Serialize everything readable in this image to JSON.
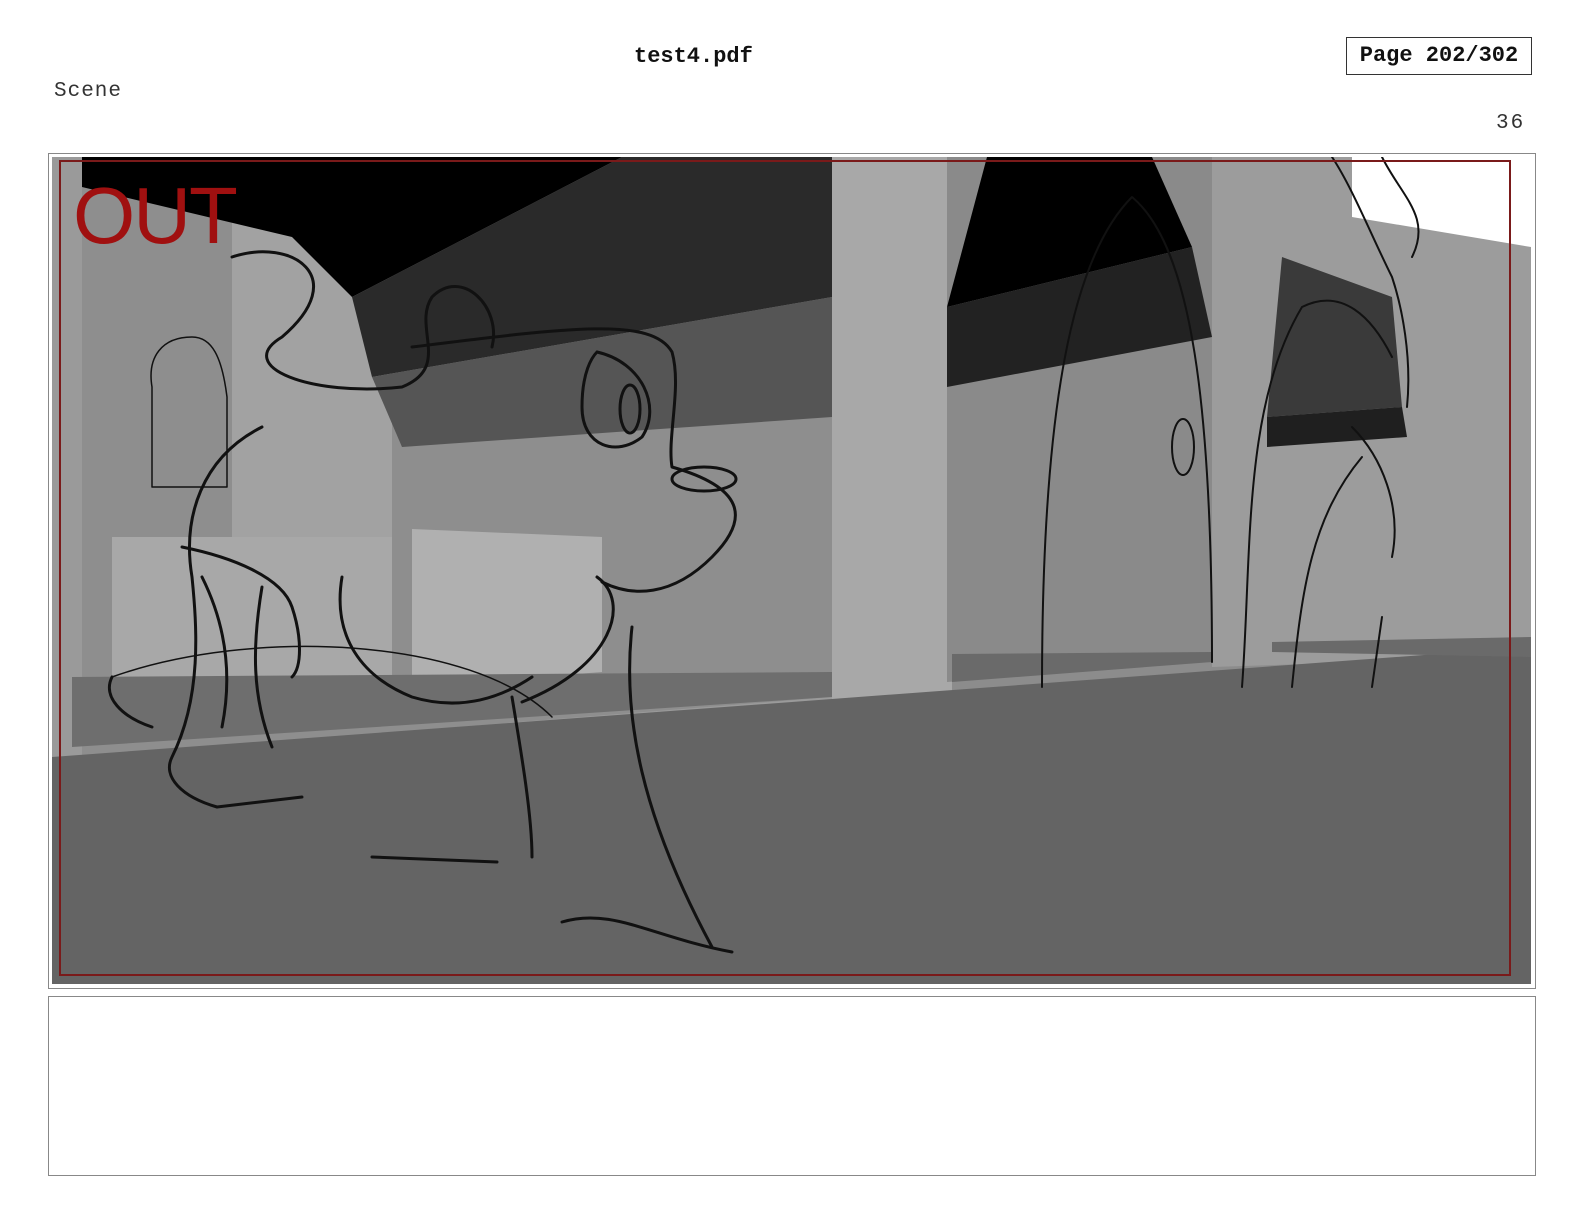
{
  "header": {
    "title": "test4.pdf",
    "page_indicator": "Page 202/302"
  },
  "scene": {
    "label": "Scene",
    "panel_number": "36"
  },
  "panel": {
    "overlay_text": "OUT",
    "overlay_color": "#a01010",
    "frame_color": "#7a1a1a"
  },
  "notes": {
    "text": ""
  }
}
